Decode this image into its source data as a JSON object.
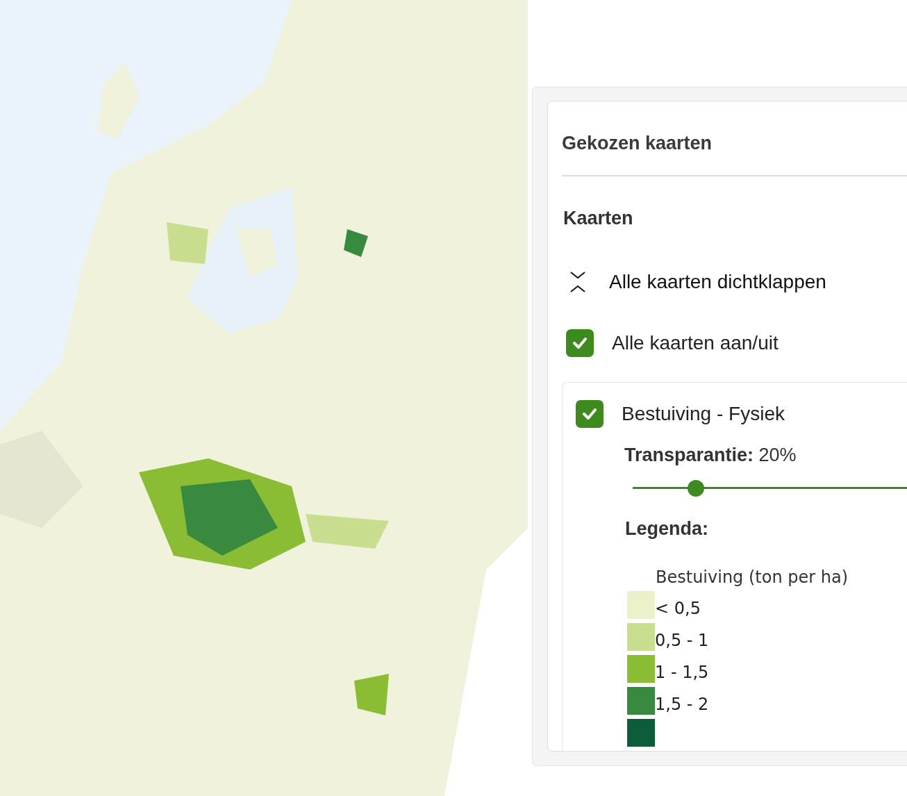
{
  "panel": {
    "title": "Gekozen kaarten",
    "section_title": "Kaarten",
    "collapse_all": {
      "label": "Alle kaarten dichtklappen"
    },
    "toggle_all": {
      "label": "Alle kaarten aan/uit",
      "checked": true
    },
    "layers": [
      {
        "name": "Bestuiving - Fysiek",
        "checked": true,
        "transparency_label": "Transparantie:",
        "transparency_value": "20%",
        "level": 0.2,
        "legend_heading": "Legenda:",
        "legend_title": "Bestuiving (ton per ha)",
        "legend_items": [
          {
            "label": "< 0,5",
            "color": "#edf1c9"
          },
          {
            "label": "0,5 - 1",
            "color": "#c9de8f"
          },
          {
            "label": "1 - 1,5",
            "color": "#8bbd34"
          },
          {
            "label": "1,5 - 2",
            "color": "#388a3f"
          },
          {
            "color": "#0d5c3a"
          }
        ]
      }
    ]
  }
}
